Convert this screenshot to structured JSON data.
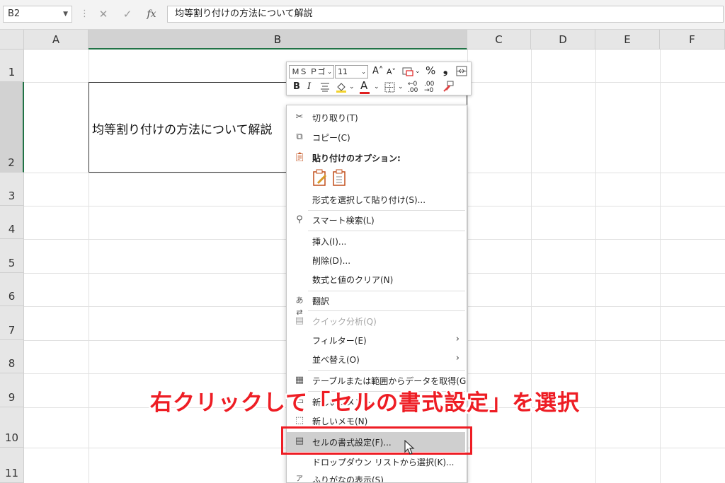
{
  "formula_bar": {
    "name_box": "B2",
    "cancel_glyph": "✕",
    "enter_glyph": "✓",
    "fx_label": "fx",
    "content": "均等割り付けの方法について解説"
  },
  "columns": [
    "A",
    "B",
    "C",
    "D",
    "E",
    "F"
  ],
  "rows": [
    "1",
    "2",
    "3",
    "4",
    "5",
    "6",
    "7",
    "8",
    "9",
    "10",
    "11"
  ],
  "cell_b2": "均等割り付けの方法について解説",
  "mini_toolbar": {
    "font_name": "ＭＳ Ｐゴ",
    "font_size": "11",
    "percent": "%",
    "comma": "❟",
    "bold": "B",
    "italic": "I",
    "font_color_letter": "A",
    "font_color": "#e02020",
    "fill_color": "#f2d22e"
  },
  "context_menu": {
    "items": [
      {
        "label": "切り取り(T)",
        "icon": "scissors-icon",
        "disabled": false
      },
      {
        "label": "コピー(C)",
        "icon": "copy-icon",
        "disabled": false
      },
      {
        "label": "貼り付けのオプション:",
        "icon": "paste-icon",
        "disabled": false
      },
      {
        "label": "形式を選択して貼り付け(S)...",
        "icon": "",
        "disabled": false
      },
      {
        "label": "スマート検索(L)",
        "icon": "smart-lookup-icon",
        "disabled": false
      },
      {
        "label": "挿入(I)...",
        "icon": "",
        "disabled": false
      },
      {
        "label": "削除(D)...",
        "icon": "",
        "disabled": false
      },
      {
        "label": "数式と値のクリア(N)",
        "icon": "",
        "disabled": false
      },
      {
        "label": "翻訳",
        "icon": "translate-icon",
        "disabled": false
      },
      {
        "label": "クイック分析(Q)",
        "icon": "quick-analysis-icon",
        "disabled": true
      },
      {
        "label": "フィルター(E)",
        "icon": "",
        "disabled": false,
        "submenu": true
      },
      {
        "label": "並べ替え(O)",
        "icon": "",
        "disabled": false,
        "submenu": true
      },
      {
        "label": "テーブルまたは範囲からデータを取得(G)...",
        "icon": "table-icon",
        "disabled": false
      },
      {
        "label": "新しいコメント",
        "icon": "new-comment-icon",
        "disabled": false
      },
      {
        "label": "新しいメモ(N)",
        "icon": "new-note-icon",
        "disabled": false
      },
      {
        "label": "セルの書式設定(F)...",
        "icon": "format-cells-icon",
        "disabled": false,
        "highlighted": true
      },
      {
        "label": "ドロップダウン リストから選択(K)...",
        "icon": "",
        "disabled": false
      },
      {
        "label": "ふりがなの表示(S)",
        "icon": "furigana-icon",
        "disabled": false
      }
    ]
  },
  "annotation": {
    "text": "右クリックして「セルの書式設定」を選択",
    "color": "#ee1d24"
  },
  "colors": {
    "selection_green": "#217346",
    "highlight_gray": "#cfcfcf"
  }
}
